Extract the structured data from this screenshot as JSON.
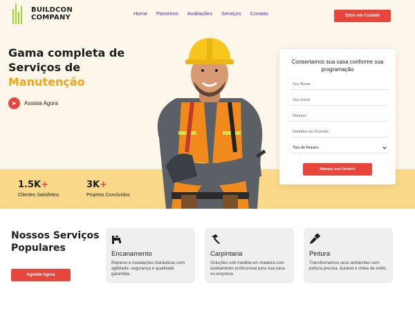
{
  "brand": {
    "line1": "BUILDCON",
    "line2": "COMPANY"
  },
  "nav": [
    "Home",
    "Parceiros",
    "Avaliações",
    "Serviços",
    "Contato"
  ],
  "header_cta": "Entre em Contato",
  "hero": {
    "line1": "Gama completa de",
    "line2": "Serviços de",
    "accent": "Manutenção",
    "watch_label": "Assista Agora"
  },
  "stats": [
    {
      "value": "1.5K",
      "plus": "+",
      "label": "Clientes Satisfeitos"
    },
    {
      "value": "3K",
      "plus": "+",
      "label": "Projetos Concluídos"
    }
  ],
  "form": {
    "title": "Consertamos sua casa conforme sua programação",
    "fields": [
      "Seu Nome",
      "Seu Email",
      "Número",
      "Detalhes da Ocorrido"
    ],
    "select": "Tipo de Reparo",
    "button": "Marque seu Horário"
  },
  "services": {
    "title": "Nossos Serviços Populares",
    "button": "Agende Agora",
    "cards": [
      {
        "title": "Encanamento",
        "text": "Reparos e instalações hidráulicas com agilidade, segurança e qualidade garantida.",
        "icon": "faucet-icon"
      },
      {
        "title": "Carpintaria",
        "text": "Soluções sob medida em madeira com acabamento profissional para sua casa ou empresa.",
        "icon": "hammer-icon"
      },
      {
        "title": "Pintura",
        "text": "Transformamos seus ambientes com pintura precisa, durável e cheia de estilo.",
        "icon": "paint-brush-icon"
      }
    ]
  },
  "colors": {
    "accent": "#e8453c",
    "highlight": "#f2a515",
    "hero_bg": "#fdf6ea",
    "stats_bg": "#fbd98a",
    "nav": "#4a35a8",
    "logo": "#9bd430"
  }
}
